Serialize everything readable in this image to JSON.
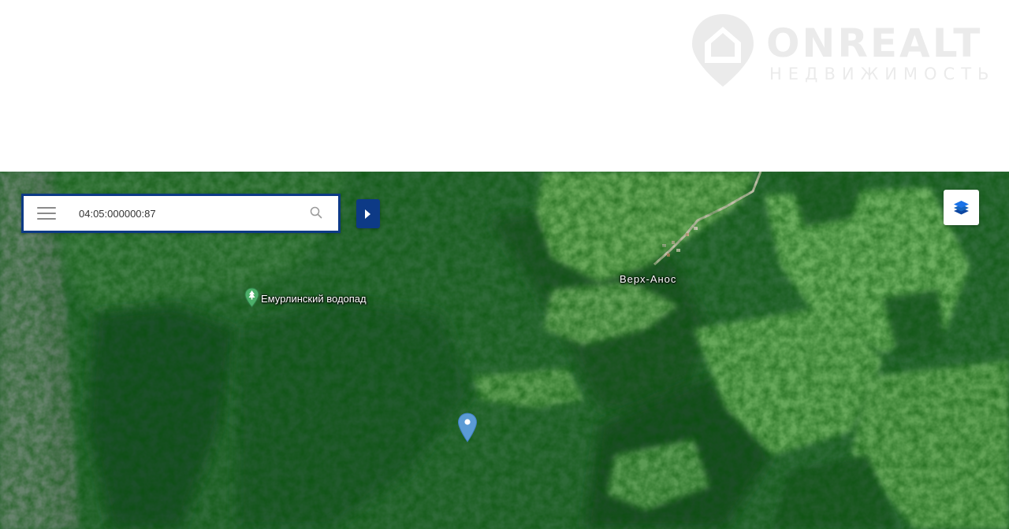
{
  "watermark": {
    "brand": "ONREALT",
    "subtitle": "НЕДВИЖИМОСТЬ"
  },
  "search": {
    "value": "04:05:000000:87",
    "menu_icon": "hamburger-menu-icon",
    "search_icon": "magnifier-icon"
  },
  "controls": {
    "expand_icon": "caret-right-icon",
    "layers_icon": "layers-icon",
    "accent_color": "#0d3a86",
    "layers_color": "#1a73e8"
  },
  "map": {
    "imagery": "satellite",
    "poi": {
      "label": "Емурлинский водопад",
      "icon": "park-tree-icon",
      "color": "#4caf6a"
    },
    "village": {
      "label": "Верх-Анос"
    },
    "pin": {
      "icon": "location-pin-icon",
      "color": "#5b9bd5"
    }
  }
}
